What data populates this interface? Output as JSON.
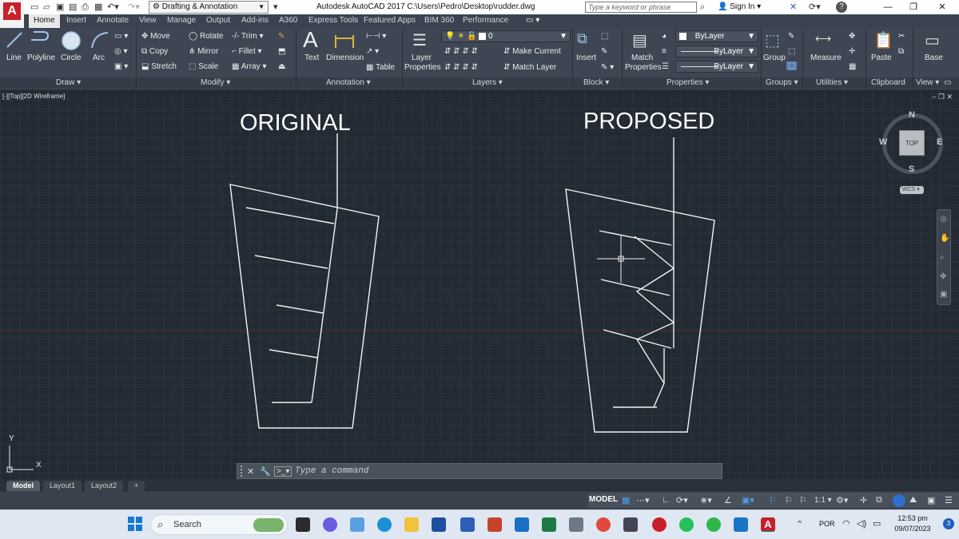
{
  "app": {
    "logo_letter": "A",
    "workspace": "Drafting & Annotation",
    "title": "Autodesk AutoCAD 2017    C:\\Users\\Pedro\\Desktop\\rudder.dwg",
    "search_placeholder": "Type a keyword or phrase",
    "sign_in": "Sign In",
    "help": "?"
  },
  "tabs": [
    {
      "label": "Home",
      "active": true
    },
    {
      "label": "Insert"
    },
    {
      "label": "Annotate"
    },
    {
      "label": "View"
    },
    {
      "label": "Manage"
    },
    {
      "label": "Output"
    },
    {
      "label": "Add-ins"
    },
    {
      "label": "A360"
    },
    {
      "label": "Express Tools"
    },
    {
      "label": "Featured Apps"
    },
    {
      "label": "BIM 360"
    },
    {
      "label": "Performance"
    }
  ],
  "ribbon": {
    "draw": {
      "title": "Draw",
      "line": "Line",
      "polyline": "Polyline",
      "circle": "Circle",
      "arc": "Arc"
    },
    "modify": {
      "title": "Modify",
      "move": "Move",
      "rotate": "Rotate",
      "trim": "Trim",
      "copy": "Copy",
      "mirror": "Mirror",
      "fillet": "Fillet",
      "stretch": "Stretch",
      "scale": "Scale",
      "array": "Array"
    },
    "annotation": {
      "title": "Annotation",
      "text": "Text",
      "dimension": "Dimension",
      "table": "Table"
    },
    "layers": {
      "title": "Layers",
      "layer_properties_1": "Layer",
      "layer_properties_2": "Properties",
      "current_layer": "0",
      "make_current": "Make Current",
      "match_layer": "Match Layer"
    },
    "block": {
      "title": "Block",
      "insert": "Insert"
    },
    "properties": {
      "title": "Properties",
      "match_1": "Match",
      "match_2": "Properties",
      "color": "ByLayer",
      "linetype": "ByLayer",
      "lineweight": "ByLayer"
    },
    "groups": {
      "title": "Groups",
      "group": "Group"
    },
    "utilities": {
      "title": "Utilities",
      "measure": "Measure"
    },
    "clipboard": {
      "title": "Clipboard",
      "paste": "Paste"
    },
    "view": {
      "title": "View",
      "base": "Base"
    }
  },
  "viewport": {
    "label": "[-][Top][2D Wireframe]",
    "label_original": "ORIGINAL",
    "label_proposed": "PROPOSED",
    "viewcube_top": "TOP",
    "compass": {
      "n": "N",
      "s": "S",
      "e": "E",
      "w": "W"
    },
    "wcs": "WCS",
    "ucs_x": "X",
    "ucs_y": "Y"
  },
  "command_line": {
    "placeholder": "Type a command"
  },
  "layout_tabs": [
    {
      "label": "Model",
      "active": true
    },
    {
      "label": "Layout1"
    },
    {
      "label": "Layout2"
    },
    {
      "label": "+"
    }
  ],
  "statusbar": {
    "model": "MODEL",
    "scale": "1:1"
  },
  "taskbar": {
    "search": "Search",
    "language": "POR",
    "time": "12:53 pm",
    "date": "09/07/2023",
    "notifications": "3"
  }
}
